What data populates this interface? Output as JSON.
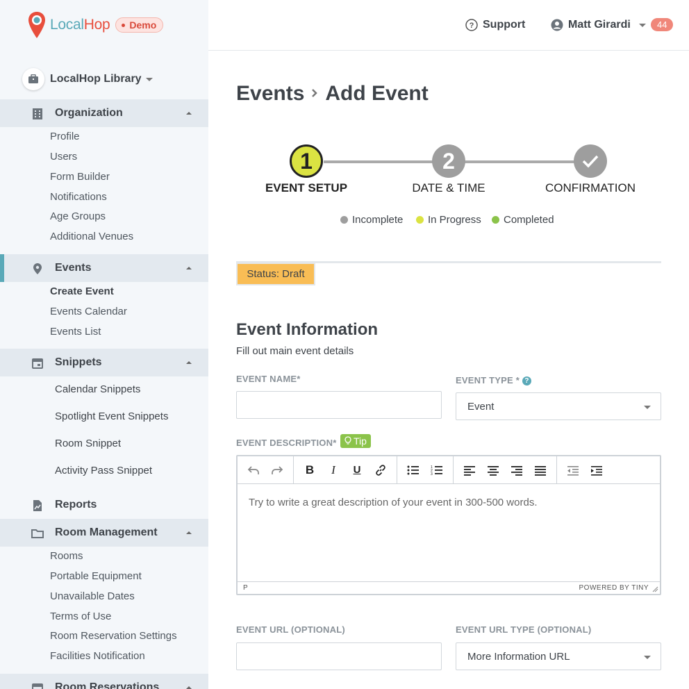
{
  "brand": {
    "name_part1": "Local",
    "name_part2": "Hop",
    "badge": "Demo"
  },
  "library": {
    "label": "LocalHop Library"
  },
  "sidebar": {
    "organization": {
      "label": "Organization",
      "items": [
        "Profile",
        "Users",
        "Form Builder",
        "Notifications",
        "Age Groups",
        "Additional Venues"
      ]
    },
    "events": {
      "label": "Events",
      "items": [
        "Create Event",
        "Events Calendar",
        "Events List"
      ]
    },
    "snippets": {
      "label": "Snippets",
      "items": [
        "Calendar Snippets",
        "Spotlight Event Snippets",
        "Room Snippet",
        "Activity Pass Snippet"
      ]
    },
    "reports": {
      "label": "Reports"
    },
    "room_management": {
      "label": "Room Management",
      "items": [
        "Rooms",
        "Portable Equipment",
        "Unavailable Dates",
        "Terms of Use",
        "Room Reservation Settings",
        "Facilities Notification"
      ]
    },
    "room_reservations": {
      "label": "Room Reservations"
    }
  },
  "header": {
    "support": "Support",
    "user": "Matt Girardi",
    "notifications": "44"
  },
  "breadcrumb": {
    "parent": "Events",
    "current": "Add Event"
  },
  "stepper": {
    "steps": [
      {
        "number": "1",
        "label": "EVENT SETUP",
        "state": "in-progress"
      },
      {
        "number": "2",
        "label": "DATE & TIME",
        "state": "incomplete"
      },
      {
        "number": "✓",
        "label": "CONFIRMATION",
        "state": "incomplete"
      }
    ],
    "legend": [
      {
        "label": "Incomplete",
        "color": "#9e9e9e"
      },
      {
        "label": "In Progress",
        "color": "#dbe342"
      },
      {
        "label": "Completed",
        "color": "#8bc34a"
      }
    ]
  },
  "status": "Status: Draft",
  "form": {
    "section_title": "Event Information",
    "section_subtitle": "Fill out main event details",
    "event_name_label": "EVENT NAME*",
    "event_name_value": "",
    "event_type_label": "EVENT TYPE *",
    "event_type_value": "Event",
    "event_description_label": "EVENT DESCRIPTION*",
    "tip_label": "Tip",
    "description_placeholder": "Try to write a great description of your event in 300-500 words.",
    "editor_path": "P",
    "editor_branding": "POWERED BY TINY",
    "event_url_label": "EVENT URL (OPTIONAL)",
    "event_url_value": "",
    "event_url_type_label": "EVENT URL TYPE (OPTIONAL)",
    "event_url_type_value": "More Information URL"
  },
  "colors": {
    "accent": "#5aa9b8",
    "brand_red": "#e84e3c",
    "status_draft": "#f9bd55",
    "tip": "#8bc34a"
  }
}
